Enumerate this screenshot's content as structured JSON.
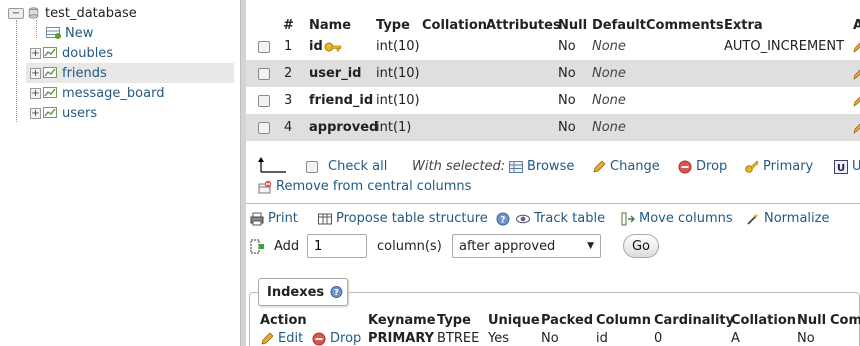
{
  "sidebar": {
    "database": "test_database",
    "items": [
      {
        "label": "New"
      },
      {
        "label": "doubles"
      },
      {
        "label": "friends"
      },
      {
        "label": "message_board"
      },
      {
        "label": "users"
      }
    ]
  },
  "structure": {
    "headers": [
      "#",
      "Name",
      "Type",
      "Collation",
      "Attributes",
      "Null",
      "Default",
      "Comments",
      "Extra",
      "A"
    ],
    "rows": [
      {
        "num": "1",
        "name": "id",
        "type": "int(10)",
        "null": "No",
        "default": "None",
        "extra": "AUTO_INCREMENT"
      },
      {
        "num": "2",
        "name": "user_id",
        "type": "int(10)",
        "null": "No",
        "default": "None",
        "extra": ""
      },
      {
        "num": "3",
        "name": "friend_id",
        "type": "int(10)",
        "null": "No",
        "default": "None",
        "extra": ""
      },
      {
        "num": "4",
        "name": "approved",
        "type": "int(1)",
        "null": "No",
        "default": "None",
        "extra": ""
      }
    ]
  },
  "bulk": {
    "check_all": "Check all",
    "with_selected": "With selected:",
    "browse": "Browse",
    "change": "Change",
    "drop": "Drop",
    "primary": "Primary",
    "unique_fragment": "U",
    "remove_central": "Remove from central columns"
  },
  "tools": {
    "print": "Print",
    "propose": "Propose table structure",
    "track": "Track table",
    "move": "Move columns",
    "normalize": "Normalize"
  },
  "add": {
    "label": "Add",
    "count": "1",
    "columns_label": "column(s)",
    "position": "after approved",
    "go": "Go"
  },
  "indexes": {
    "legend": "Indexes",
    "headers": [
      "Action",
      "Keyname",
      "Type",
      "Unique",
      "Packed",
      "Column",
      "Cardinality",
      "Collation",
      "Null",
      "Com"
    ],
    "row": {
      "edit": "Edit",
      "drop": "Drop",
      "keyname": "PRIMARY",
      "type": "BTREE",
      "unique": "Yes",
      "packed": "No",
      "column": "id",
      "cardinality": "0",
      "collation": "A",
      "null": "No"
    }
  }
}
